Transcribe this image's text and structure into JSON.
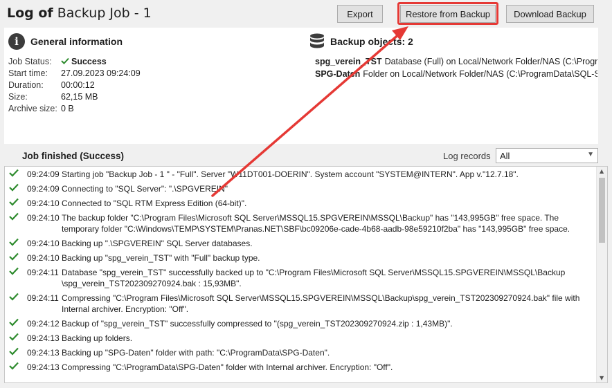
{
  "header": {
    "title_bold": "Log of",
    "title_rest": "Backup Job - 1",
    "export_label": "Export",
    "restore_label": "Restore from Backup",
    "download_label": "Download Backup"
  },
  "general": {
    "heading": "General information",
    "rows": [
      {
        "label": "Job Status:",
        "value": "Success"
      },
      {
        "label": "Start time:",
        "value": "27.09.2023 09:24:09"
      },
      {
        "label": "Duration:",
        "value": "00:00:12"
      },
      {
        "label": "Size:",
        "value": "62,15 MB"
      },
      {
        "label": "Archive size:",
        "value": "0 B"
      }
    ]
  },
  "backup_objects": {
    "heading": "Backup objects: 2",
    "items": [
      {
        "icon": "database-icon",
        "name": "spg_verein_TST",
        "desc": "Database (Full) on Local/Network Folder/NAS (C:\\Progra..."
      },
      {
        "icon": "folder-icon",
        "name": "SPG-Daten",
        "desc": "Folder on Local/Network Folder/NAS (C:\\ProgramData\\SQL-S..."
      }
    ]
  },
  "job": {
    "title": "Job finished (Success)",
    "log_records_label": "Log records",
    "log_records_value": "All"
  },
  "log": [
    {
      "time": "09:24:09",
      "msg": "Starting job \"Backup Job - 1 \" - \"Full\". Server \"W11DT001-DOERIN\". System account \"SYSTEM@INTERN\". App v.\"12.7.18\"."
    },
    {
      "time": "09:24:09",
      "msg": "Connecting to \"SQL Server\": \".\\SPGVEREIN\""
    },
    {
      "time": "09:24:10",
      "msg": "Connected to \"SQL RTM Express Edition (64-bit)\"."
    },
    {
      "time": "09:24:10",
      "msg": "The backup folder \"C:\\Program Files\\Microsoft SQL Server\\MSSQL15.SPGVEREIN\\MSSQL\\Backup\" has \"143,995GB\" free space. The temporary folder \"C:\\Windows\\TEMP\\SYSTEM\\Pranas.NET\\SBF\\bc09206e-cade-4b68-aadb-98e59210f2ba\" has \"143,995GB\" free space."
    },
    {
      "time": "09:24:10",
      "msg": "Backing up \".\\SPGVEREIN\" SQL Server databases."
    },
    {
      "time": "09:24:10",
      "msg": "Backing up \"spg_verein_TST\" with \"Full\" backup type."
    },
    {
      "time": "09:24:11",
      "msg": "Database \"spg_verein_TST\" successfully backed up to \"C:\\Program Files\\Microsoft SQL Server\\MSSQL15.SPGVEREIN\\MSSQL\\Backup \\spg_verein_TST202309270924.bak : 15,93MB\"."
    },
    {
      "time": "09:24:11",
      "msg": "Compressing \"C:\\Program Files\\Microsoft SQL Server\\MSSQL15.SPGVEREIN\\MSSQL\\Backup\\spg_verein_TST202309270924.bak\" file with Internal archiver. Encryption: \"Off\"."
    },
    {
      "time": "09:24:12",
      "msg": "Backup of \"spg_verein_TST\" successfully compressed to \"(spg_verein_TST202309270924.zip : 1,43MB)\"."
    },
    {
      "time": "09:24:13",
      "msg": "Backing up folders."
    },
    {
      "time": "09:24:13",
      "msg": "Backing up \"SPG-Daten\" folder with path: \"C:\\ProgramData\\SPG-Daten\"."
    },
    {
      "time": "09:24:13",
      "msg": "Compressing \"C:\\ProgramData\\SPG-Daten\" folder with Internal archiver. Encryption: \"Off\"."
    }
  ],
  "colors": {
    "success": "#2e8b2e",
    "highlight": "#e53935"
  }
}
